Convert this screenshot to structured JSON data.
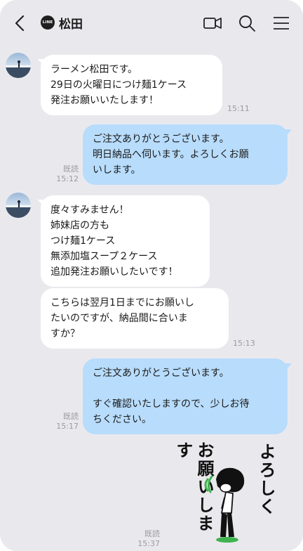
{
  "header": {
    "contact_name": "松田",
    "line_badge": "LINE",
    "icons": [
      "chevron-left-icon",
      "video-call-icon",
      "search-icon",
      "menu-icon"
    ]
  },
  "messages": [
    {
      "from": "them",
      "text": "ラーメン松田です。\n29日の火曜日につけ麺1ケース\n発注お願いいたします！",
      "time": "15:11"
    },
    {
      "from": "me",
      "text": "ご注文ありがとうございます。\n明日納品へ伺います。よろしくお願\nいします。",
      "read": "既読",
      "time": "15:12"
    },
    {
      "from": "them",
      "text": "度々すみません！\n姉妹店の方も\nつけ麺1ケース\n無添加塩スープ２ケース\n追加発注お願いしたいです！",
      "time": ""
    },
    {
      "from": "them",
      "text": "こちらは翌月1日までにお願いし\nたいのですが、納品間に合いま\nすか？",
      "time": "15:13"
    },
    {
      "from": "me",
      "text": "ご注文ありがとうございます。\n\nすぐ確認いたしますので、少しお待\nちください。",
      "read": "既読",
      "time": "15:17"
    }
  ],
  "sticker": {
    "caption_right": "よろしく",
    "caption_left": "お願いします",
    "read": "既読",
    "time": "15:37"
  },
  "colors": {
    "background": "#e9e9ed",
    "incoming_bubble": "#ffffff",
    "outgoing_bubble": "#b8dcfb",
    "meta_text": "#9a9aa2"
  }
}
